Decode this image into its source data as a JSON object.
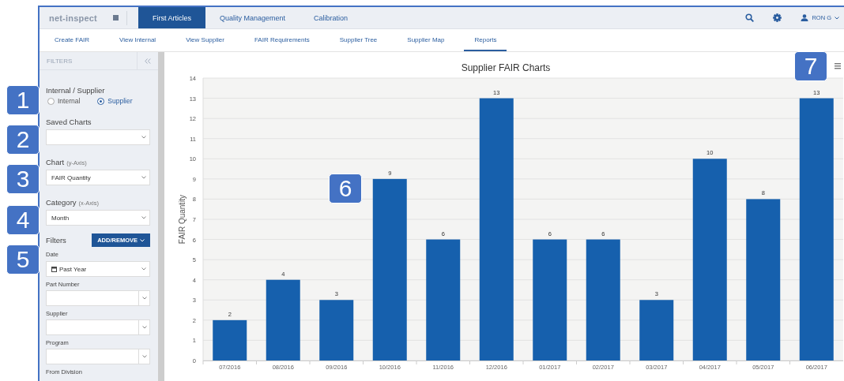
{
  "logo": "**net**-inspect",
  "main_tabs": [
    {
      "label": "First Articles",
      "selected": true
    },
    {
      "label": "Quality Management",
      "selected": false
    },
    {
      "label": "Calibration",
      "selected": false
    }
  ],
  "user": {
    "name": "RON G"
  },
  "sub_tabs": [
    {
      "label": "Create FAIR",
      "selected": false
    },
    {
      "label": "View Internal",
      "selected": false
    },
    {
      "label": "View Supplier",
      "selected": false
    },
    {
      "label": "FAIR Requirements",
      "selected": false
    },
    {
      "label": "Supplier Tree",
      "selected": false
    },
    {
      "label": "Supplier Map",
      "selected": false
    },
    {
      "label": "Reports",
      "selected": true
    }
  ],
  "filters_panel": {
    "title": "FILTERS",
    "source": {
      "label": "Internal / Supplier",
      "options": [
        {
          "label": "Internal",
          "selected": false
        },
        {
          "label": "Supplier",
          "selected": true
        }
      ]
    },
    "saved_charts": {
      "label": "Saved Charts"
    },
    "chart": {
      "label": "Chart",
      "hint": "(y-Axis)",
      "value": "FAIR Quantity"
    },
    "category": {
      "label": "Category",
      "hint": "(x-Axis)",
      "value": "Month"
    },
    "filters": {
      "label": "Filters",
      "button": "ADD/REMOVE"
    },
    "fields": [
      {
        "label": "Date",
        "kind": "date",
        "value": "Past Year"
      },
      {
        "label": "Part Number",
        "kind": "combo"
      },
      {
        "label": "Supplier",
        "kind": "combo"
      },
      {
        "label": "Program",
        "kind": "combo"
      },
      {
        "label": "From Division",
        "kind": "none"
      }
    ]
  },
  "chart_data": {
    "type": "bar",
    "title": "Supplier FAIR Charts",
    "ylabel": "FAIR Quantity",
    "categories": [
      "07/2016",
      "08/2016",
      "09/2016",
      "10/2016",
      "11/2016",
      "12/2016",
      "01/2017",
      "02/2017",
      "03/2017",
      "04/2017",
      "05/2017",
      "06/2017"
    ],
    "series": [
      {
        "color": "#1660ad",
        "values": [
          2,
          4,
          3,
          9,
          6,
          13,
          6,
          6,
          3,
          10,
          8,
          13
        ]
      }
    ],
    "grid": true,
    "ylim": [
      0,
      14
    ],
    "yticks": [
      0,
      1,
      2,
      3,
      4,
      5,
      6,
      7,
      8,
      9,
      10,
      11,
      12,
      13,
      14
    ],
    "data_labels": true
  },
  "callouts": [
    {
      "label": "1"
    },
    {
      "label": "2"
    },
    {
      "label": "3"
    },
    {
      "label": "4"
    },
    {
      "label": "5"
    },
    {
      "label": "6"
    },
    {
      "label": "7"
    }
  ]
}
